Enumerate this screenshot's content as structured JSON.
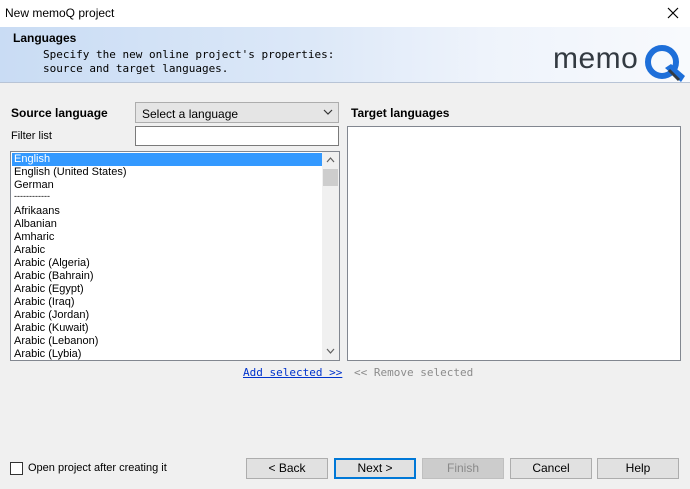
{
  "window": {
    "title": "New memoQ project"
  },
  "header": {
    "title": "Languages",
    "description": "Specify the new online project's properties:\nsource and target languages.",
    "logo_text": "memo",
    "logo_mark": "Q"
  },
  "source": {
    "label": "Source language",
    "select_value": "Select a language",
    "filter_label": "Filter list",
    "filter_value": "",
    "items": [
      "English",
      "English (United States)",
      "German",
      "------------",
      "Afrikaans",
      "Albanian",
      "Amharic",
      "Arabic",
      "Arabic (Algeria)",
      "Arabic (Bahrain)",
      "Arabic (Egypt)",
      "Arabic (Iraq)",
      "Arabic (Jordan)",
      "Arabic (Kuwait)",
      "Arabic (Lebanon)",
      "Arabic (Lybia)"
    ],
    "selected_index": 0
  },
  "target": {
    "label": "Target languages",
    "items": []
  },
  "links": {
    "add": "Add selected >>",
    "remove": "<< Remove selected"
  },
  "footer": {
    "checkbox_label": "Open project after creating it",
    "checkbox_checked": false,
    "back": "< Back",
    "next": "Next >",
    "finish": "Finish",
    "cancel": "Cancel",
    "help": "Help"
  },
  "colors": {
    "selection": "#3399ff",
    "logo_accent": "#1e6fd9",
    "link": "#0033cc"
  }
}
